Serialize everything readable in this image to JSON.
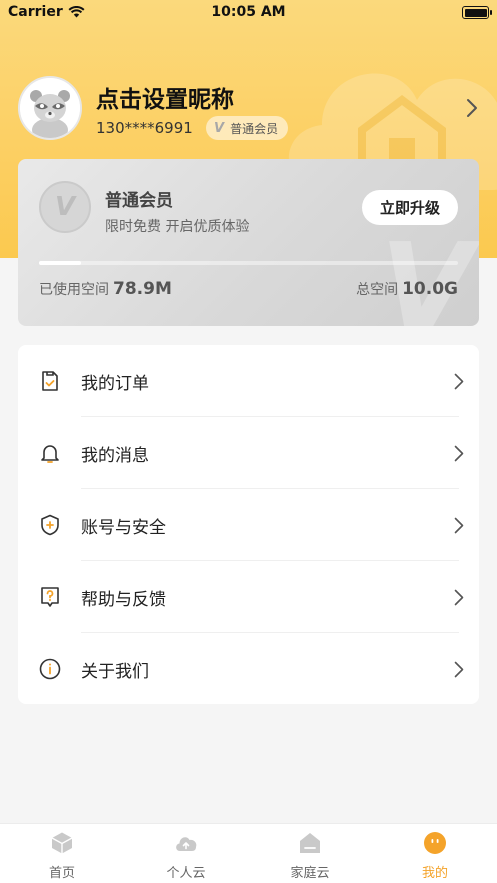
{
  "status_bar": {
    "carrier": "Carrier",
    "time": "10:05 AM"
  },
  "profile": {
    "nickname": "点击设置昵称",
    "phone": "130****6991",
    "member_badge": "普通会员",
    "member_badge_icon": "V"
  },
  "vip_card": {
    "logo_letter": "V",
    "title": "普通会员",
    "subtitle": "限时免费 开启优质体验",
    "upgrade_label": "立即升级",
    "used_label": "已使用空间",
    "used_value": "78.9M",
    "total_label": "总空间",
    "total_value": "10.0G",
    "usage_fraction": 0.1
  },
  "menu": {
    "items": [
      {
        "label": "我的订单",
        "icon": "order-icon"
      },
      {
        "label": "我的消息",
        "icon": "bell-icon"
      },
      {
        "label": "账号与安全",
        "icon": "shield-icon"
      },
      {
        "label": "帮助与反馈",
        "icon": "help-icon"
      },
      {
        "label": "关于我们",
        "icon": "info-icon"
      }
    ]
  },
  "tabbar": {
    "tabs": [
      {
        "label": "首页",
        "icon": "home-cube-icon"
      },
      {
        "label": "个人云",
        "icon": "cloud-upload-icon"
      },
      {
        "label": "家庭云",
        "icon": "family-home-icon"
      },
      {
        "label": "我的",
        "icon": "me-face-icon"
      }
    ],
    "active_index": 3
  },
  "colors": {
    "header": "#fccf62",
    "accent": "#f4a32a",
    "card": "#d9d9d9"
  }
}
